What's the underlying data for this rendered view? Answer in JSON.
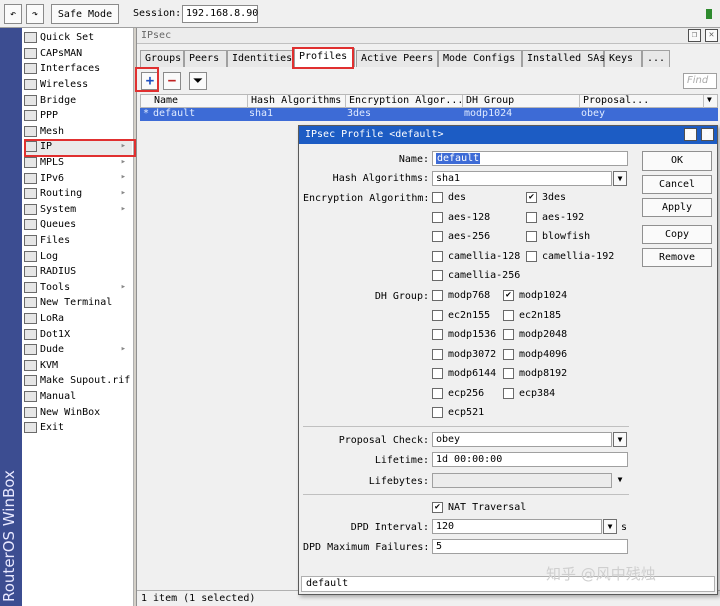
{
  "toolbar": {
    "safe_mode": "Safe Mode",
    "session_label": "Session:",
    "session_value": "192.168.8.90"
  },
  "brand": {
    "text": "RouterOS WinBox"
  },
  "sidebar": {
    "items": [
      {
        "label": "Quick Set"
      },
      {
        "label": "CAPsMAN"
      },
      {
        "label": "Interfaces"
      },
      {
        "label": "Wireless"
      },
      {
        "label": "Bridge"
      },
      {
        "label": "PPP"
      },
      {
        "label": "Mesh"
      },
      {
        "label": "IP",
        "arrow": "▸"
      },
      {
        "label": "MPLS",
        "arrow": "▸"
      },
      {
        "label": "IPv6",
        "arrow": "▸"
      },
      {
        "label": "Routing",
        "arrow": "▸"
      },
      {
        "label": "System",
        "arrow": "▸"
      },
      {
        "label": "Queues"
      },
      {
        "label": "Files"
      },
      {
        "label": "Log"
      },
      {
        "label": "RADIUS"
      },
      {
        "label": "Tools",
        "arrow": "▸"
      },
      {
        "label": "New Terminal"
      },
      {
        "label": "LoRa"
      },
      {
        "label": "Dot1X"
      },
      {
        "label": "Dude",
        "arrow": "▸"
      },
      {
        "label": "KVM"
      },
      {
        "label": "Make Supout.rif"
      },
      {
        "label": "Manual"
      },
      {
        "label": "New WinBox"
      },
      {
        "label": "Exit"
      }
    ]
  },
  "ipsec": {
    "title": "IPsec",
    "tabs": [
      "Groups",
      "Peers",
      "Identities",
      "Profiles",
      "Active Peers",
      "Mode Configs",
      "Installed SAs",
      "Keys",
      "..."
    ],
    "find_placeholder": "Find",
    "columns": [
      "Name",
      "Hash Algorithms",
      "Encryption Algor...",
      "DH Group",
      "Proposal..."
    ],
    "row": {
      "marker": "*",
      "name": "default",
      "hash": "sha1",
      "enc": "3des",
      "dh": "modp1024",
      "proposal": "obey"
    },
    "status": "1 item (1 selected)"
  },
  "dialog": {
    "title": "IPsec Profile <default>",
    "name_label": "Name:",
    "name_value": "default",
    "hash_label": "Hash Algorithms:",
    "hash_value": "sha1",
    "enc_label": "Encryption Algorithm:",
    "enc_options": [
      {
        "label": "des",
        "checked": false
      },
      {
        "label": "3des",
        "checked": true
      },
      {
        "label": "aes-128",
        "checked": false
      },
      {
        "label": "aes-192",
        "checked": false
      },
      {
        "label": "aes-256",
        "checked": false
      },
      {
        "label": "blowfish",
        "checked": false
      },
      {
        "label": "camellia-128",
        "checked": false
      },
      {
        "label": "camellia-192",
        "checked": false
      },
      {
        "label": "camellia-256",
        "checked": false
      }
    ],
    "dh_label": "DH Group:",
    "dh_options": [
      {
        "label": "modp768",
        "checked": false
      },
      {
        "label": "modp1024",
        "checked": true
      },
      {
        "label": "ec2n155",
        "checked": false
      },
      {
        "label": "ec2n185",
        "checked": false
      },
      {
        "label": "modp1536",
        "checked": false
      },
      {
        "label": "modp2048",
        "checked": false
      },
      {
        "label": "modp3072",
        "checked": false
      },
      {
        "label": "modp4096",
        "checked": false
      },
      {
        "label": "modp6144",
        "checked": false
      },
      {
        "label": "modp8192",
        "checked": false
      },
      {
        "label": "ecp256",
        "checked": false
      },
      {
        "label": "ecp384",
        "checked": false
      },
      {
        "label": "ecp521",
        "checked": false
      }
    ],
    "proposal_label": "Proposal Check:",
    "proposal_value": "obey",
    "lifetime_label": "Lifetime:",
    "lifetime_value": "1d 00:00:00",
    "lifebytes_label": "Lifebytes:",
    "lifebytes_value": "",
    "nat_label": "NAT Traversal",
    "nat_checked": true,
    "dpd_label": "DPD Interval:",
    "dpd_value": "120",
    "dpd_unit": "s",
    "dpdmax_label": "DPD Maximum Failures:",
    "dpdmax_value": "5",
    "buttons": {
      "ok": "OK",
      "cancel": "Cancel",
      "apply": "Apply",
      "copy": "Copy",
      "remove": "Remove"
    },
    "status": "default"
  },
  "watermark": "知乎 @风中残烛"
}
